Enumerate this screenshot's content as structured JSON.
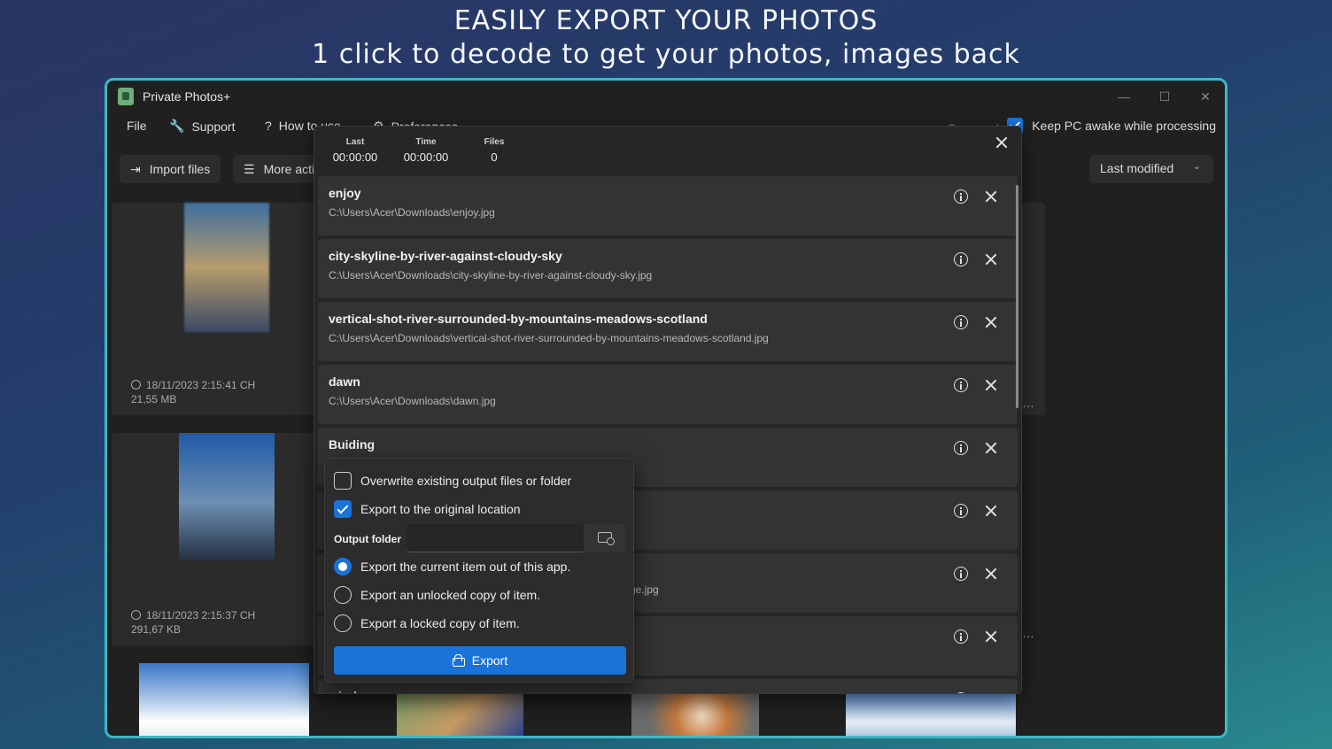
{
  "promo": {
    "line1": "EASILY EXPORT YOUR PHOTOS",
    "line2": "1 click to decode to get your photos, images back"
  },
  "app": {
    "title": "Private Photos+",
    "accent": "#1a73d9",
    "frame_color": "#3fb7c4"
  },
  "menu": {
    "file": "File",
    "support": "Support",
    "how_to_use": "How to use",
    "preferences": "Preferences",
    "processed": "Processed",
    "keep_awake": "Keep PC awake while processing",
    "keep_awake_checked": true
  },
  "toolbar": {
    "import": "Import files",
    "more": "More actions",
    "sort": "Last modified"
  },
  "gallery": [
    {
      "date": "18/11/2023 2:15:41 CH",
      "size": "21,55 MB"
    },
    {
      "date": "18/11/2023 2:15:37 CH",
      "size": "291,67 KB"
    }
  ],
  "modal": {
    "stats": [
      {
        "label": "Last",
        "value": "00:00:00"
      },
      {
        "label": "Time",
        "value": "00:00:00"
      },
      {
        "label": "Files",
        "value": "0"
      }
    ],
    "items": [
      {
        "name": "enjoy",
        "path": "C:\\Users\\Acer\\Downloads\\enjoy.jpg"
      },
      {
        "name": "city-skyline-by-river-against-cloudy-sky",
        "path": "C:\\Users\\Acer\\Downloads\\city-skyline-by-river-against-cloudy-sky.jpg"
      },
      {
        "name": "vertical-shot-river-surrounded-by-mountains-meadows-scotland",
        "path": "C:\\Users\\Acer\\Downloads\\vertical-shot-river-surrounded-by-mountains-meadows-scotland.jpg"
      },
      {
        "name": "dawn",
        "path": "C:\\Users\\Acer\\Downloads\\dawn.jpg"
      },
      {
        "name": "Buiding",
        "path": ""
      },
      {
        "name": "",
        "path": ""
      },
      {
        "name": "",
        "path": "ge.jpg"
      },
      {
        "name": "",
        "path": ""
      },
      {
        "name": "window",
        "path": ""
      }
    ]
  },
  "export_flyout": {
    "overwrite": "Overwrite existing output files or folder",
    "overwrite_checked": false,
    "original_location": "Export to the original location",
    "original_location_checked": true,
    "output_folder_label": "Output folder",
    "output_folder_value": "",
    "options": [
      {
        "label": "Export the current item out of this app.",
        "selected": true
      },
      {
        "label": "Export an unlocked copy of item.",
        "selected": false
      },
      {
        "label": "Export a locked copy of item.",
        "selected": false
      }
    ],
    "export_button": "Export"
  }
}
